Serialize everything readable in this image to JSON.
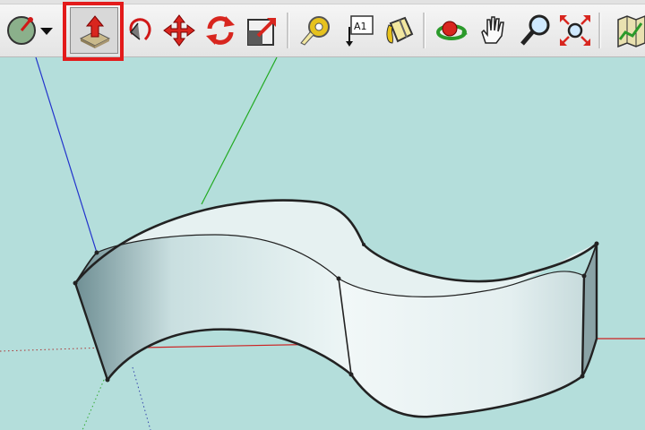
{
  "app": "3D modeling",
  "colors": {
    "canvas_background": "#b4dedb",
    "highlight_border": "#e31b1b",
    "axis_red": "#cc2222",
    "axis_green": "#22aa22",
    "axis_blue": "#2233cc"
  },
  "toolbar": {
    "tools": [
      {
        "name": "dropdown-tool",
        "icon": "compass-icon"
      },
      {
        "name": "dropdown-arrow",
        "icon": "chevron-down-icon"
      },
      {
        "name": "push-pull-tool",
        "icon": "push-pull-icon",
        "active": true
      },
      {
        "name": "follow-me-tool",
        "icon": "follow-me-icon"
      },
      {
        "name": "move-tool",
        "icon": "move-icon"
      },
      {
        "name": "rotate-tool",
        "icon": "rotate-icon"
      },
      {
        "name": "scale-tool",
        "icon": "scale-icon"
      },
      {
        "name": "tape-measure-tool",
        "icon": "tape-measure-icon"
      },
      {
        "name": "text-tool",
        "icon": "text-label-icon",
        "label": "A1"
      },
      {
        "name": "paint-bucket-tool",
        "icon": "paint-bucket-icon"
      },
      {
        "name": "orbit-tool",
        "icon": "orbit-icon"
      },
      {
        "name": "pan-tool",
        "icon": "hand-icon"
      },
      {
        "name": "zoom-tool",
        "icon": "magnifier-icon"
      },
      {
        "name": "zoom-extents-tool",
        "icon": "zoom-extents-icon"
      },
      {
        "name": "previous-view-tool",
        "icon": "map-icon"
      }
    ]
  },
  "model": {
    "shape": "S-curve extruded wall"
  }
}
